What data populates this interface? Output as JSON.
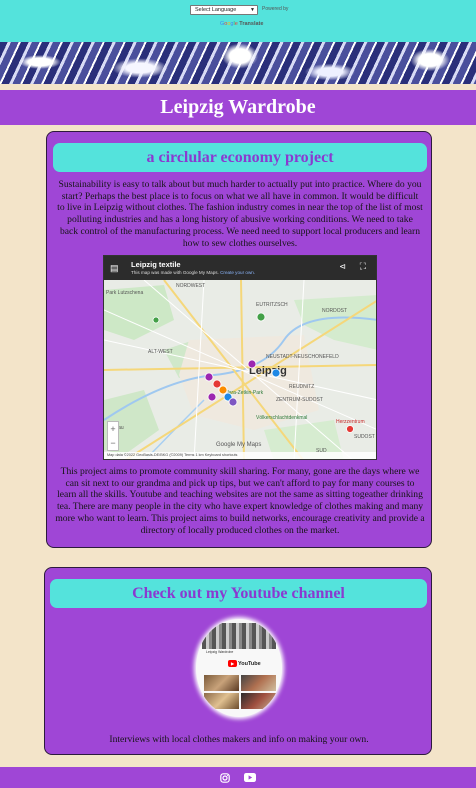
{
  "translate": {
    "select_label": "Select Language",
    "powered_by": "Powered by",
    "google_letters": [
      "G",
      "o",
      "o",
      "g",
      "l",
      "e"
    ],
    "translate_label": "Translate"
  },
  "site": {
    "title": "Leipzig Wardrobe"
  },
  "project_section": {
    "heading": "a circlular economy project",
    "intro": "Sustainability is easy to talk about but much harder to actually put into practice. Where do you start? Perhaps the best place is to focus on what we all have in common. It would be difficult to live in Leipzig without clothes. The fashion industry comes in near the top of the list of most polluting industries and has a long history of abusive working conditions. We need to take back control of the manufacturing process. We need need to support local producers and learn how to sew clothes ourselves.",
    "map": {
      "title": "Leipzig textile",
      "subtitle": "This map was made with Google My Maps.",
      "subtitle_link": "Create your own.",
      "attribution": "Map data ©2022 GeoBasis-DE/BKG (©2009)   Terms   1 km   Keyboard shortcuts",
      "brand": "Google My Maps",
      "place_labels": [
        "Park Lutzschena",
        "NORDWEST",
        "EUTRITZSCH",
        "NORDOST",
        "Leipzig",
        "ALT-WEST",
        "NEUSTADT-NEUSCHONEFELD",
        "Clara-Zetkin-Park",
        "REUDNITZ",
        "ZENTRUM-SUDOST",
        "Grünau",
        "Völkerschlachtdenkmal",
        "Herzzentrum",
        "SUDOST",
        "SUD"
      ]
    },
    "outro": "This project aims to promote community skill sharing. For many, gone are the days where we can sit next to our grandma and pick up tips, but we can't afford to pay for many courses to learn all the skills. Youtube and teaching websites are not the same as sitting togeather drinking tea. There are many people in the city who have expert knowledge of clothes making and many more who want to learn. This project aims to build networks, encourage creativity and provide a directory of locally produced clothes on the market."
  },
  "youtube_section": {
    "heading": "Check out my Youtube channel",
    "channel_name": "Leipzig Wardrobe",
    "logo_text": "YouTube",
    "description": "Interviews with local clothes makers and info on making your own."
  },
  "footer": {
    "icons": [
      "instagram-icon",
      "youtube-icon"
    ]
  },
  "colors": {
    "teal": "#54e3dc",
    "purple": "#9f46d6",
    "cream": "#f3e4c9",
    "heading_purple": "#8a3ad0"
  }
}
